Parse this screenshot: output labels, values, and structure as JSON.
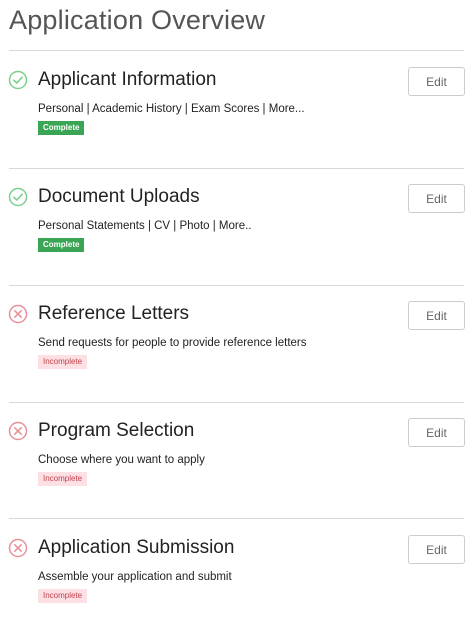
{
  "page": {
    "title": "Application Overview"
  },
  "sections": [
    {
      "title": "Applicant Information",
      "description": "Personal | Academic History | Exam Scores | More...",
      "status": "Complete",
      "state": "complete",
      "icon": "check-circle-icon",
      "edit_label": "Edit"
    },
    {
      "title": "Document Uploads",
      "description": "Personal Statements | CV | Photo | More..",
      "status": "Complete",
      "state": "complete",
      "icon": "check-circle-icon",
      "edit_label": "Edit"
    },
    {
      "title": "Reference Letters",
      "description": "Send requests for people to provide reference letters",
      "status": "Incomplete",
      "state": "incomplete",
      "icon": "x-circle-icon",
      "edit_label": "Edit"
    },
    {
      "title": "Program Selection",
      "description": "Choose where you want to apply",
      "status": "Incomplete",
      "state": "incomplete",
      "icon": "x-circle-icon",
      "edit_label": "Edit"
    },
    {
      "title": "Application Submission",
      "description": "Assemble your application and submit",
      "status": "Incomplete",
      "state": "incomplete",
      "icon": "x-circle-icon",
      "edit_label": "Edit"
    }
  ],
  "colors": {
    "complete": "#3aa655",
    "incomplete_bg": "#fde0e3",
    "incomplete_text": "#c0434e",
    "check_icon": "#7ccf8e",
    "x_icon": "#e8919a"
  }
}
